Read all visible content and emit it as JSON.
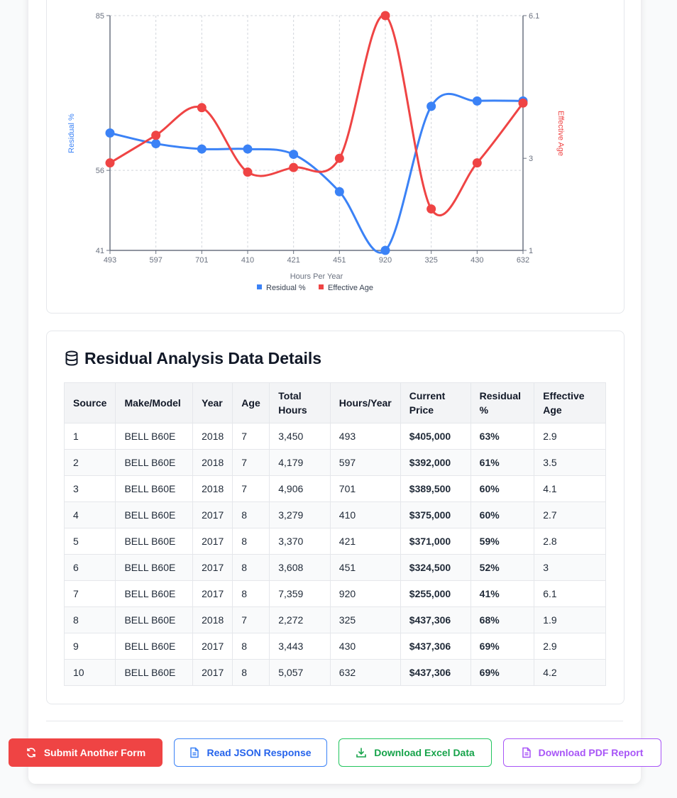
{
  "chart_data": {
    "type": "line",
    "x": [
      "493",
      "597",
      "701",
      "410",
      "421",
      "451",
      "920",
      "325",
      "430",
      "632"
    ],
    "xlabel": "Hours Per Year",
    "ylabel": "Residual %",
    "y2label": "Effective Age",
    "ylim": [
      41,
      85
    ],
    "y2lim": [
      1,
      6.1
    ],
    "yticks": [
      "85",
      "56",
      "41"
    ],
    "y2ticks": [
      "6.1",
      "3",
      "1"
    ],
    "grid": true,
    "legend": "bottom",
    "series": [
      {
        "name": "Residual %",
        "axis": "left",
        "color": "#3b82f6",
        "values": [
          63,
          61,
          60,
          60,
          59,
          52,
          41,
          68,
          69,
          69
        ]
      },
      {
        "name": "Effective Age",
        "axis": "right",
        "color": "#ef4444",
        "values": [
          2.9,
          3.5,
          4.1,
          2.7,
          2.8,
          3,
          6.1,
          1.9,
          2.9,
          4.2
        ]
      }
    ]
  },
  "details": {
    "title": "Residual Analysis Data Details",
    "icon": "database-icon",
    "columns": [
      "Source",
      "Make/Model",
      "Year",
      "Age",
      "Total Hours",
      "Hours/Year",
      "Current Price",
      "Residual %",
      "Effective Age"
    ],
    "rows": [
      [
        "1",
        "BELL B60E",
        "2018",
        "7",
        "3,450",
        "493",
        "$405,000",
        "63%",
        "2.9"
      ],
      [
        "2",
        "BELL B60E",
        "2018",
        "7",
        "4,179",
        "597",
        "$392,000",
        "61%",
        "3.5"
      ],
      [
        "3",
        "BELL B60E",
        "2018",
        "7",
        "4,906",
        "701",
        "$389,500",
        "60%",
        "4.1"
      ],
      [
        "4",
        "BELL B60E",
        "2017",
        "8",
        "3,279",
        "410",
        "$375,000",
        "60%",
        "2.7"
      ],
      [
        "5",
        "BELL B60E",
        "2017",
        "8",
        "3,370",
        "421",
        "$371,000",
        "59%",
        "2.8"
      ],
      [
        "6",
        "BELL B60E",
        "2017",
        "8",
        "3,608",
        "451",
        "$324,500",
        "52%",
        "3"
      ],
      [
        "7",
        "BELL B60E",
        "2017",
        "8",
        "7,359",
        "920",
        "$255,000",
        "41%",
        "6.1"
      ],
      [
        "8",
        "BELL B60E",
        "2018",
        "7",
        "2,272",
        "325",
        "$437,306",
        "68%",
        "1.9"
      ],
      [
        "9",
        "BELL B60E",
        "2017",
        "8",
        "3,443",
        "430",
        "$437,306",
        "69%",
        "2.9"
      ],
      [
        "10",
        "BELL B60E",
        "2017",
        "8",
        "5,057",
        "632",
        "$437,306",
        "69%",
        "4.2"
      ]
    ]
  },
  "actions": {
    "submit_label": "Submit Another Form",
    "json_label": "Read JSON Response",
    "excel_label": "Download Excel Data",
    "pdf_label": "Download PDF Report"
  },
  "colors": {
    "residual": "#3b82f6",
    "effective_age": "#ef4444",
    "price": "#16a34a",
    "submit": "#ef4444",
    "pdf": "#a855f7"
  }
}
